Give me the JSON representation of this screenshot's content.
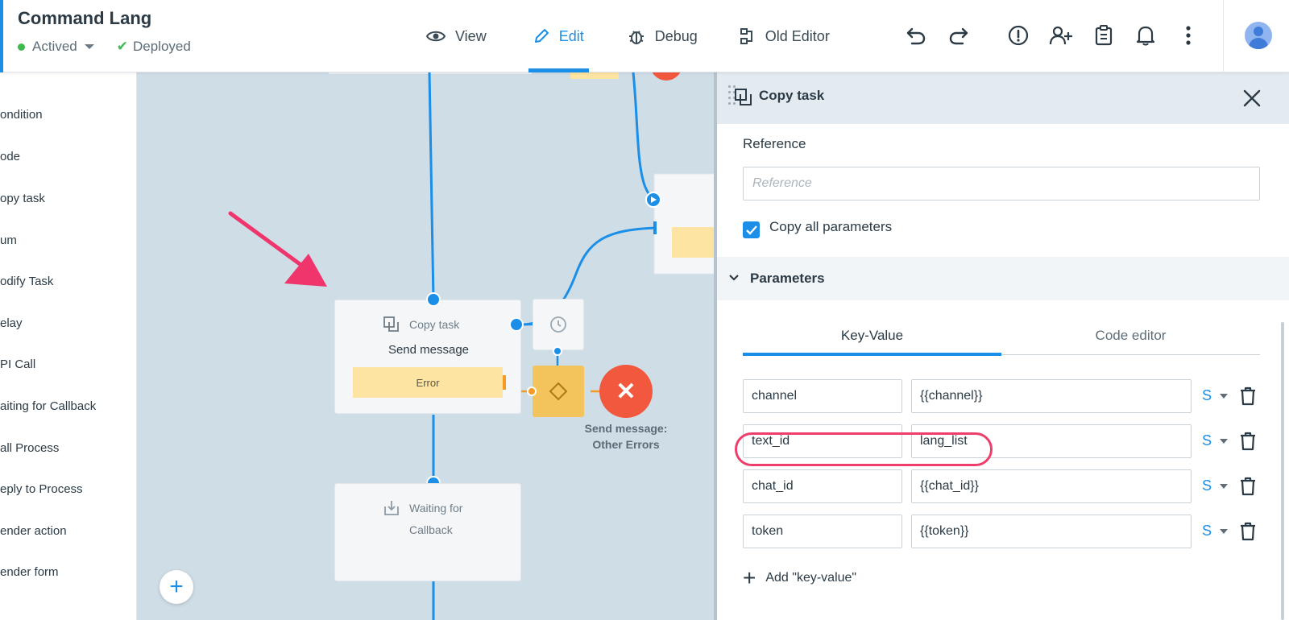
{
  "header": {
    "title": "Command Lang",
    "status": "Actived",
    "deploy_status": "Deployed",
    "tabs": [
      {
        "label": "View",
        "icon": "eye-icon"
      },
      {
        "label": "Edit",
        "icon": "pencil-icon",
        "active": true
      },
      {
        "label": "Debug",
        "icon": "bug-icon"
      },
      {
        "label": "Old Editor",
        "icon": "schema-icon"
      }
    ],
    "tools": [
      "undo-icon",
      "redo-icon",
      "alert-circle-icon",
      "add-user-icon",
      "clipboard-icon",
      "bell-icon",
      "more-vertical-icon"
    ],
    "accent_color": "#1b8ee8"
  },
  "sidebar": {
    "items": [
      {
        "label": "ondition"
      },
      {
        "label": "ode"
      },
      {
        "label": "opy task"
      },
      {
        "label": "um"
      },
      {
        "label": "odify Task"
      },
      {
        "label": "elay"
      },
      {
        "label": "PI Call"
      },
      {
        "label": "aiting for Callback"
      },
      {
        "label": "all Process"
      },
      {
        "label": "eply to Process"
      },
      {
        "label": "ender action"
      },
      {
        "label": "ender form"
      }
    ]
  },
  "canvas": {
    "copy_node": {
      "type": "Copy task",
      "title": "Send message",
      "error_label": "Error"
    },
    "callback_node": {
      "type_line1": "Waiting for",
      "type_line2": "Callback"
    },
    "end_node": {
      "label_line1": "Send message:",
      "label_line2": "Other Errors",
      "color": "#f2583e"
    },
    "add_button": "+"
  },
  "panel": {
    "title": "Copy task",
    "reference_label": "Reference",
    "reference_placeholder": "Reference",
    "reference_value": "",
    "copy_all_label": "Copy all parameters",
    "copy_all_checked": true,
    "section_title": "Parameters",
    "tabs": [
      "Key-Value",
      "Code editor"
    ],
    "active_tab": "Key-Value",
    "params": [
      {
        "key": "channel",
        "value": "{{channel}}",
        "type": "S"
      },
      {
        "key": "text_id",
        "value": "lang_list",
        "type": "S"
      },
      {
        "key": "chat_id",
        "value": "{{chat_id}}",
        "type": "S"
      },
      {
        "key": "token",
        "value": "{{token}}",
        "type": "S"
      }
    ],
    "add_label": "Add \"key-value\""
  }
}
